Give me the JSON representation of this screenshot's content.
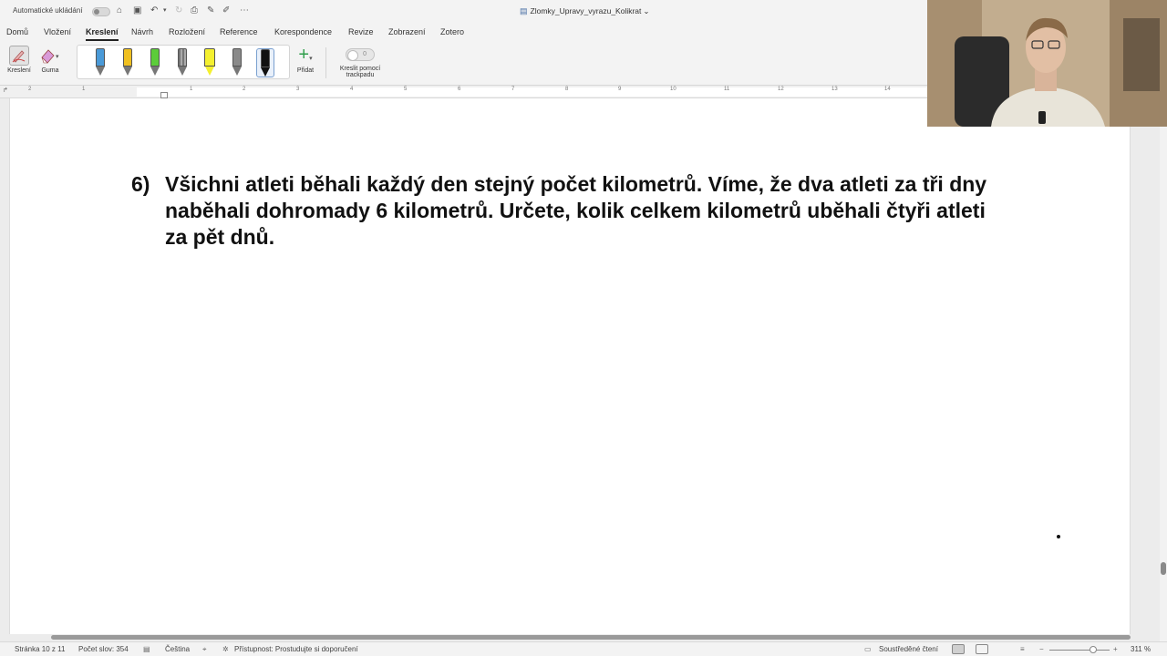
{
  "titlebar": {
    "autosave_label": "Automatické ukládání",
    "document_title": "Zlomky_Upravy_vyrazu_Kolikrat",
    "title_chevron": "⌄"
  },
  "tabs": [
    "Domů",
    "Vložení",
    "Kreslení",
    "Návrh",
    "Rozložení",
    "Reference",
    "Korespondence",
    "Revize",
    "Zobrazení",
    "Zotero"
  ],
  "active_tab": "Kreslení",
  "ribbon": {
    "draw_label": "Kreslení",
    "eraser_label": "Guma",
    "add_label": "Přidat",
    "trackpad_label_1": "Kreslit pomocí",
    "trackpad_label_2": "trackpadu",
    "trackpad_toggle_value": "0",
    "pens": [
      {
        "name": "blue-pen",
        "color": "#4a9ad8"
      },
      {
        "name": "yellow-pen",
        "color": "#f0c020"
      },
      {
        "name": "green-pen",
        "color": "#5ccc3a"
      },
      {
        "name": "pencil-gray",
        "color": "#666666"
      },
      {
        "name": "yellow-highlighter",
        "color": "#f4f030"
      },
      {
        "name": "gray-pen",
        "color": "#8a8a8a"
      },
      {
        "name": "black-pen",
        "color": "#111111"
      }
    ]
  },
  "ruler": {
    "numbers": [
      "2",
      "1",
      "1",
      "2",
      "3",
      "4",
      "5",
      "6",
      "7",
      "8",
      "9",
      "10",
      "11",
      "12",
      "13",
      "14"
    ]
  },
  "document": {
    "problem_number": "6)",
    "problem_text": "Všichni atleti běhali každý den stejný počet kilometrů. Víme, že dva atleti za tři dny naběhali dohromady 6 kilometrů. Určete, kolik celkem kilometrů uběhali čtyři atleti za pět dnů."
  },
  "statusbar": {
    "page": "Stránka 10 z 11",
    "word_count": "Počet slov: 354",
    "language": "Čeština",
    "accessibility": "Přístupnost: Prostudujte si doporučení",
    "focus_mode": "Soustředěné čtení",
    "zoom": "311 %"
  }
}
